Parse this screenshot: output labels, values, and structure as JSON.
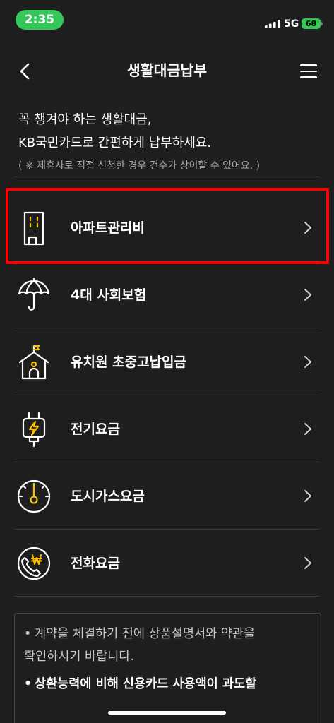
{
  "status_bar": {
    "time": "2:35",
    "network": "5G",
    "battery": "68",
    "signal_icon": "cellular-signal-icon"
  },
  "header": {
    "title": "생활대금납부",
    "back_icon": "chevron-left-icon",
    "menu_icon": "hamburger-menu-icon"
  },
  "intro": {
    "line1": "꼭 챙겨야 하는 생활대금,",
    "line2": "KB국민카드로 간편하게 납부하세요.",
    "note": "( ※ 제휴사로 직접 신청한 경우 건수가 상이할 수 있어요. )"
  },
  "menu": {
    "chevron_icon": "chevron-right-icon",
    "items": [
      {
        "label": "아파트관리비",
        "icon": "apartment-building-icon",
        "highlighted": true
      },
      {
        "label": "4대 사회보험",
        "icon": "umbrella-icon",
        "highlighted": false
      },
      {
        "label": "유치원 초중고납입금",
        "icon": "school-icon",
        "highlighted": false
      },
      {
        "label": "전기요금",
        "icon": "electric-plug-icon",
        "highlighted": false
      },
      {
        "label": "도시가스요금",
        "icon": "gas-gauge-icon",
        "highlighted": false
      },
      {
        "label": "전화요금",
        "icon": "phone-won-icon",
        "highlighted": false
      }
    ]
  },
  "notice": {
    "bullet": "•",
    "items": [
      {
        "lines": [
          "계약을 체결하기 전에 상품설명서와 약관을",
          "확인하시기 바랍니다."
        ],
        "emphasis": false
      },
      {
        "lines": [
          "상환능력에 비해 신용카드 사용액이 과도할"
        ],
        "emphasis": true
      }
    ]
  },
  "colors": {
    "background": "#1e1e1e",
    "text": "#ffffff",
    "muted_text": "#a8a8a8",
    "notice_text": "#c9c9c9",
    "divider": "#3a3a3a",
    "accent_yellow": "#ffc400",
    "status_green": "#34c759",
    "highlight_red": "#ff0000"
  }
}
